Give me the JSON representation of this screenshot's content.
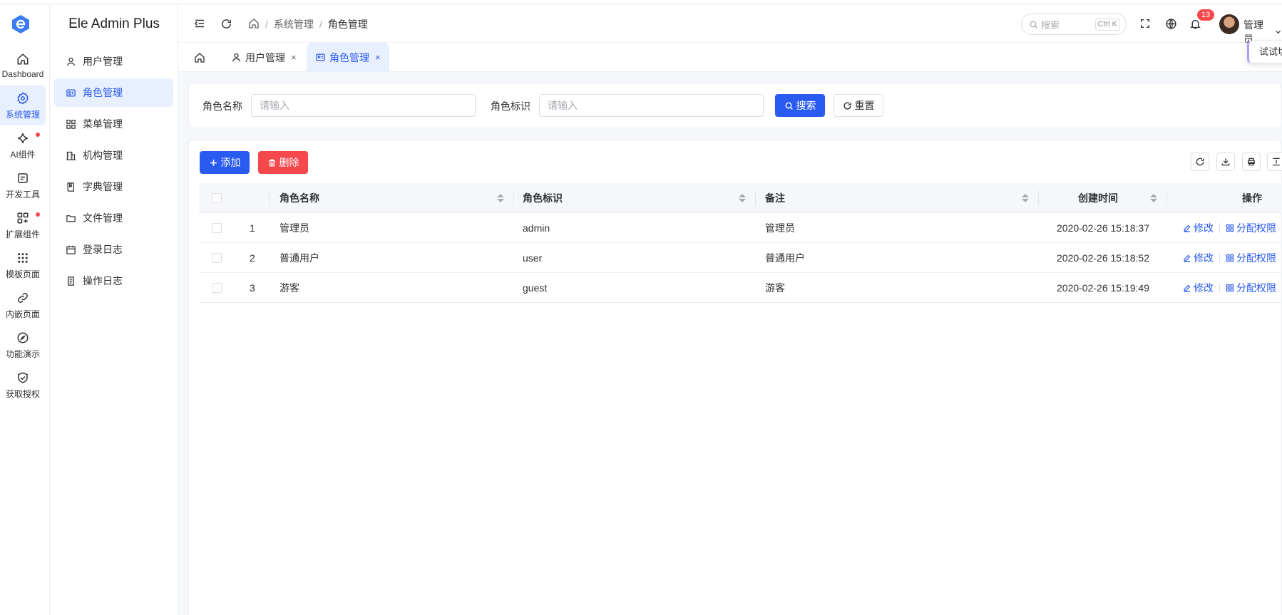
{
  "colors": {
    "accent": "#2a5bf0",
    "danger": "#f5484d",
    "accent_bg": "#e8efff"
  },
  "rail": {
    "items": [
      {
        "label": "Dashboard",
        "icon": "home-icon"
      },
      {
        "label": "系统管理",
        "icon": "gear-icon"
      },
      {
        "label": "AI组件",
        "icon": "sparkle-icon"
      },
      {
        "label": "开发工具",
        "icon": "tool-icon"
      },
      {
        "label": "扩展组件",
        "icon": "grid-plus-icon"
      },
      {
        "label": "模板页面",
        "icon": "dots-grid-icon"
      },
      {
        "label": "内嵌页面",
        "icon": "link-icon"
      },
      {
        "label": "功能演示",
        "icon": "compass-icon"
      },
      {
        "label": "获取授权",
        "icon": "shield-check-icon"
      }
    ]
  },
  "submenu": {
    "brand": "Ele Admin Plus",
    "items": [
      {
        "label": "用户管理",
        "icon": "user-icon"
      },
      {
        "label": "角色管理",
        "icon": "id-card-icon"
      },
      {
        "label": "菜单管理",
        "icon": "apps-icon"
      },
      {
        "label": "机构管理",
        "icon": "building-icon"
      },
      {
        "label": "字典管理",
        "icon": "book-icon"
      },
      {
        "label": "文件管理",
        "icon": "folder-icon"
      },
      {
        "label": "登录日志",
        "icon": "calendar-icon"
      },
      {
        "label": "操作日志",
        "icon": "document-icon"
      }
    ]
  },
  "header": {
    "breadcrumb": [
      "系统管理",
      "角色管理"
    ],
    "search_placeholder": "搜索",
    "search_shortcut": "Ctrl K",
    "notification_count": "13",
    "user_name": "管理员"
  },
  "tabs": [
    {
      "label": "用户管理"
    },
    {
      "label": "角色管理"
    }
  ],
  "float_tip": "试试切",
  "search_form": {
    "role_name_label": "角色名称",
    "role_name_placeholder": "请输入",
    "role_code_label": "角色标识",
    "role_code_placeholder": "请输入",
    "search_label": "搜索",
    "reset_label": "重置"
  },
  "toolbar": {
    "add_label": "添加",
    "delete_label": "删除"
  },
  "table": {
    "headers": {
      "name": "角色名称",
      "code": "角色标识",
      "remark": "备注",
      "created": "创建时间",
      "action": "操作"
    },
    "rows": [
      {
        "index": "1",
        "name": "管理员",
        "code": "admin",
        "remark": "管理员",
        "created": "2020-02-26 15:18:37"
      },
      {
        "index": "2",
        "name": "普通用户",
        "code": "user",
        "remark": "普通用户",
        "created": "2020-02-26 15:18:52"
      },
      {
        "index": "3",
        "name": "游客",
        "code": "guest",
        "remark": "游客",
        "created": "2020-02-26 15:19:49"
      }
    ],
    "edit_label": "修改",
    "assign_label": "分配权限"
  }
}
